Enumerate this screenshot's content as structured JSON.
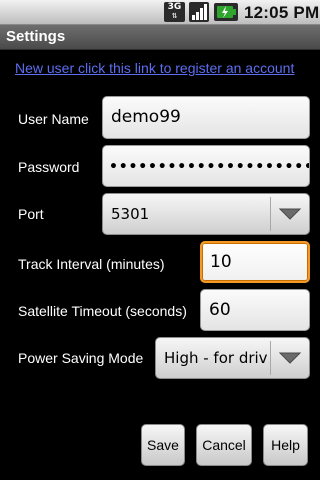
{
  "status_bar": {
    "network_label": "3G",
    "network_arrows": "⇅",
    "time": "12:05 PM",
    "icons": [
      "network-3g-icon",
      "signal-strength-icon",
      "battery-charging-icon"
    ]
  },
  "title_bar": {
    "title": "Settings"
  },
  "register_link": {
    "text": "New user click this link to register an account"
  },
  "form": {
    "username": {
      "label": "User Name",
      "value": "demo99"
    },
    "password": {
      "label": "Password",
      "masked_value": "••••••••••••••••••••••"
    },
    "port": {
      "label": "Port",
      "selected": "5301"
    },
    "track_interval": {
      "label": "Track Interval (minutes)",
      "value": "10"
    },
    "satellite_timeout": {
      "label": "Satellite Timeout (seconds)",
      "value": "60"
    },
    "power_saving_mode": {
      "label": "Power Saving Mode",
      "selected": "High - for driving"
    }
  },
  "buttons": {
    "save": "Save",
    "cancel": "Cancel",
    "help": "Help"
  },
  "colors": {
    "link": "#5d6ef0",
    "focus_border": "#f39a25",
    "battery_green": "#2fa52f"
  }
}
